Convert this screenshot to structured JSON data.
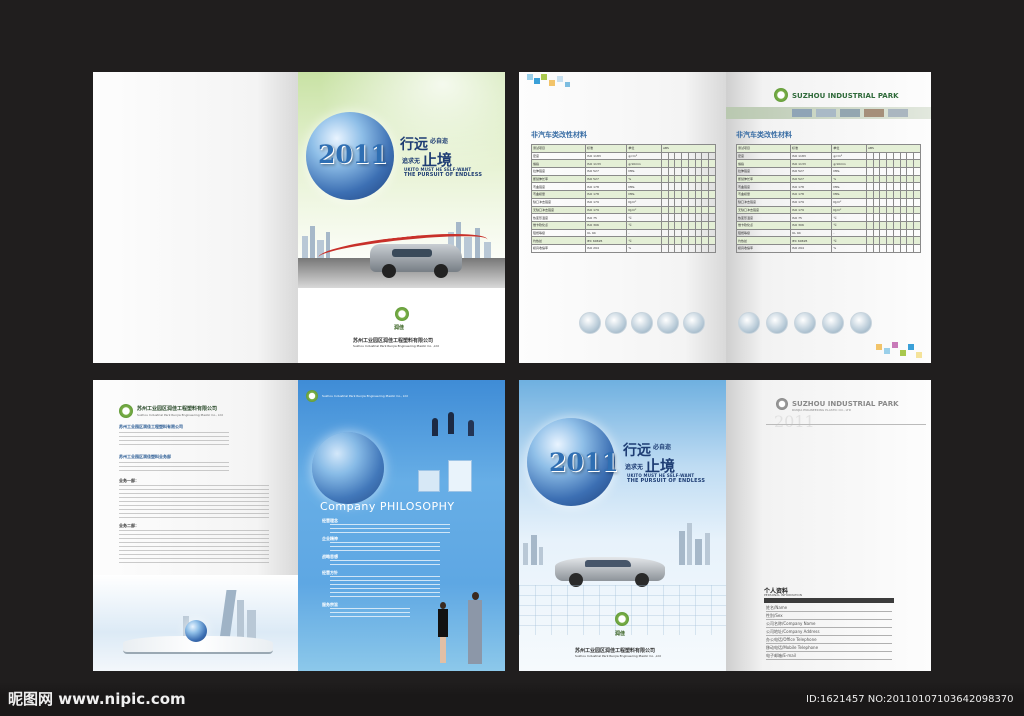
{
  "cover1": {
    "year": "2011",
    "title_a": "行远",
    "title_small": "必自迩",
    "title_b": "止境",
    "title_small2": "追求无",
    "sub_en1": "UKITO MUST HE SELF-WANT",
    "sub_en2": "THE PURSUIT OF ENDLESS",
    "brand": "润佳",
    "brand_en": "RUNJIA",
    "company_cn": "苏州工业园区润佳工程塑料有限公司",
    "company_en": "Suzhou Industrial Park Runjia Engineering Plastic Co. ,Ltd"
  },
  "spread2": {
    "heading": "非汽车类改性材料",
    "park": "SUZHOU INDUSTRIAL PARK",
    "col_headers": [
      "测试项目",
      "标准",
      "单位",
      "ABS"
    ],
    "rows": [
      [
        "密度",
        "ISO 1183",
        "g/cm³"
      ],
      [
        "熔指",
        "ISO 1133",
        "g/10min"
      ],
      [
        "拉伸强度",
        "ISO 527",
        "MPa"
      ],
      [
        "断裂伸长率",
        "ISO 527",
        "%"
      ],
      [
        "弯曲强度",
        "ISO 178",
        "MPa"
      ],
      [
        "弯曲模量",
        "ISO 178",
        "MPa"
      ],
      [
        "缺口冲击强度",
        "ISO 179",
        "KJ/m²"
      ],
      [
        "无缺口冲击强度",
        "ISO 179",
        "KJ/m²"
      ],
      [
        "热变形温度",
        "ISO 75",
        "℃"
      ],
      [
        "维卡软化点",
        "ISO 306",
        "℃"
      ],
      [
        "阻燃等级",
        "UL 94",
        "-"
      ],
      [
        "灼热丝",
        "IEC 60695",
        "℃"
      ],
      [
        "模具收缩率",
        "ISO 294",
        "%"
      ]
    ]
  },
  "contacts": {
    "company": "苏州工业园区润佳工程塑料有限公司",
    "company_en": "Suzhou Industrial Park Runjia Engineering Plastic Co., Ltd",
    "section1": "苏州工业园区润佳工程塑料有限公司",
    "section2": "苏州工业园区润佳塑料业务部",
    "section3": "业务一部：",
    "section4": "业务二部："
  },
  "philosophy": {
    "title": "Company PHILOSOPHY",
    "header_en": "Suzhou Industrial Park Runjia Engineering Plastic Co., Ltd",
    "item1": "经营理念",
    "item2": "企业精神",
    "item3": "战略思想",
    "item4": "经营方针",
    "item5": "服务宗旨"
  },
  "back": {
    "park": "SUZHOU INDUSTRIAL PARK",
    "park_sub": "RUNJIA ENGINEERING PLASTIC CO., LTD",
    "year": "2011",
    "section_cn": "个人资料",
    "section_en": "PERSONAL INFORMATION",
    "fields": [
      "姓名/Name",
      "性别/Sex",
      "公司名称/Company Name",
      "公司地址/Company Address",
      "办公电话/Office Telephone",
      "移动电话/Mobile Telephone",
      "电子邮箱/E-mail"
    ]
  },
  "watermark": {
    "site": "昵图网 www.nipic.com",
    "id": "ID:1621457 NO:20110107103642098370"
  }
}
